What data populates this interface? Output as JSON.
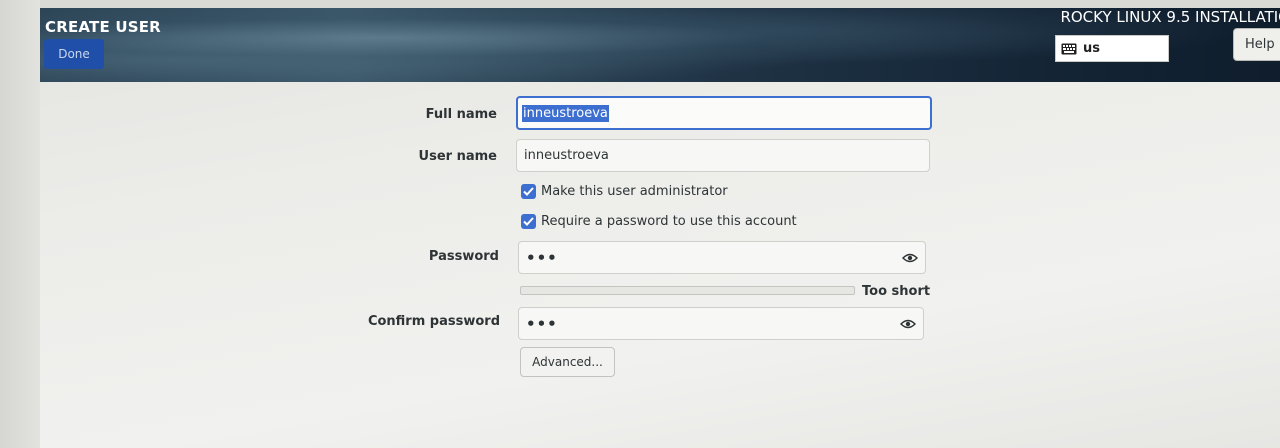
{
  "header": {
    "page_title": "CREATE USER",
    "done_label": "Done",
    "installer_title": "ROCKY LINUX 9.5 INSTALLATIO",
    "keyboard_layout": "us",
    "keyboard_icon": "keyboard-icon",
    "help_label": "Help"
  },
  "form": {
    "full_name": {
      "label": "Full name",
      "value": "inneustroeva",
      "selected": true
    },
    "user_name": {
      "label": "User name",
      "value": "inneustroeva"
    },
    "admin_checkbox": {
      "label": "Make this user administrator",
      "checked": true
    },
    "require_password_checkbox": {
      "label": "Require a password to use this account",
      "checked": true
    },
    "password": {
      "label": "Password",
      "masked_value": "•••",
      "icon": "eye-icon"
    },
    "strength": {
      "label": "Too short",
      "level": 0
    },
    "confirm_password": {
      "label": "Confirm password",
      "masked_value": "•••",
      "icon": "eye-icon"
    },
    "advanced_label": "Advanced..."
  },
  "colors": {
    "accent": "#3d6fd1",
    "done_button": "#1f4fa8",
    "header_dark": "#142536"
  }
}
